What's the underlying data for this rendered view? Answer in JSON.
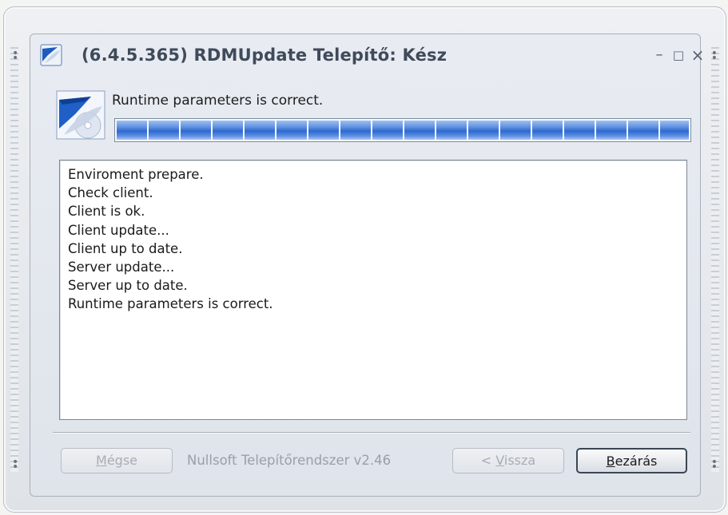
{
  "window": {
    "title": "(6.4.5.365) RDMUpdate Telepítő: Kész",
    "controls": {
      "minimize": "–",
      "maximize": "□",
      "close": "×"
    }
  },
  "header": {
    "status_text": "Runtime parameters is correct.",
    "progress": 1.0
  },
  "log": {
    "lines": [
      "Enviroment prepare.",
      "Check client.",
      "Client is ok.",
      "Client update...",
      "Client up to date.",
      "Server update...",
      "Server up to date.",
      "Runtime parameters is correct."
    ]
  },
  "footer": {
    "cancel": {
      "accel": "M",
      "rest": "égse",
      "enabled": false
    },
    "branding": "Nullsoft Telepítőrendszer v2.46",
    "back": {
      "prefix": "< ",
      "accel": "V",
      "rest": "issza",
      "enabled": false
    },
    "close": {
      "accel": "B",
      "rest": "ezárás",
      "enabled": true
    }
  },
  "colors": {
    "accent": "#2f69d0",
    "title_text": "#3f4a5a",
    "disabled_text": "#a8adb5"
  },
  "icons": [
    "installer-app-icon",
    "installer-header-icon",
    "minimize-icon",
    "maximize-icon",
    "close-icon"
  ]
}
